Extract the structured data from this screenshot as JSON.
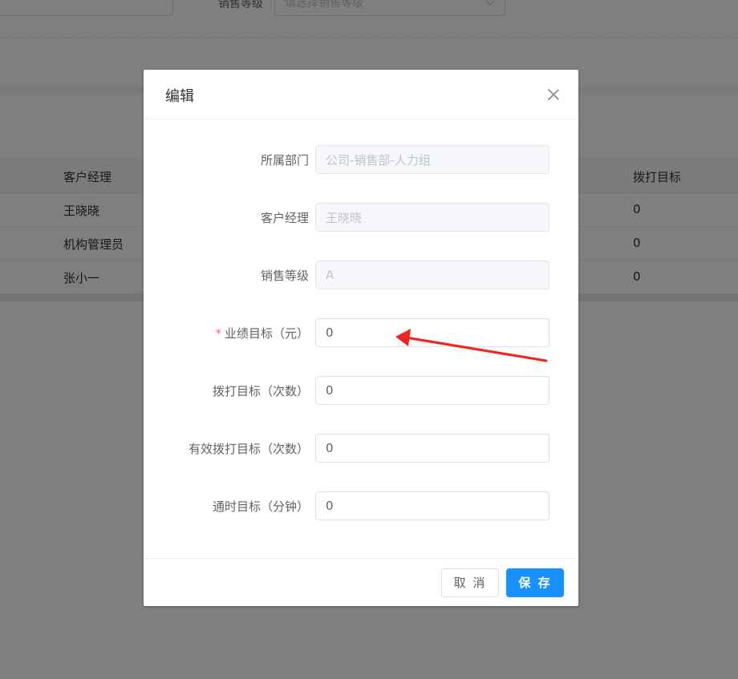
{
  "background": {
    "filter_label": "销售等级",
    "filter_placeholder": "请选择销售等级",
    "table": {
      "headers": [
        "客户经理",
        "拨打目标"
      ],
      "rows": [
        [
          "王晓晓",
          "0"
        ],
        [
          "机构管理员",
          "0"
        ],
        [
          "张小一",
          "0"
        ]
      ]
    }
  },
  "dialog": {
    "title": "编辑",
    "fields": [
      {
        "label": "所属部门",
        "value": "公司-销售部-人力组",
        "disabled": true,
        "required": false
      },
      {
        "label": "客户经理",
        "value": "王晓晓",
        "disabled": true,
        "required": false
      },
      {
        "label": "销售等级",
        "value": "A",
        "disabled": true,
        "required": false
      },
      {
        "label": "业绩目标（元）",
        "value": "0",
        "disabled": false,
        "required": true
      },
      {
        "label": "拨打目标（次数）",
        "value": "0",
        "disabled": false,
        "required": false
      },
      {
        "label": "有效拨打目标（次数）",
        "value": "0",
        "disabled": false,
        "required": false
      },
      {
        "label": "通时目标（分钟）",
        "value": "0",
        "disabled": false,
        "required": false
      }
    ],
    "cancel_label": "取 消",
    "save_label": "保 存"
  },
  "annotation": {
    "arrow_color": "#f5221c"
  },
  "colors": {
    "primary": "#1890ff",
    "required": "#f56c6c"
  }
}
